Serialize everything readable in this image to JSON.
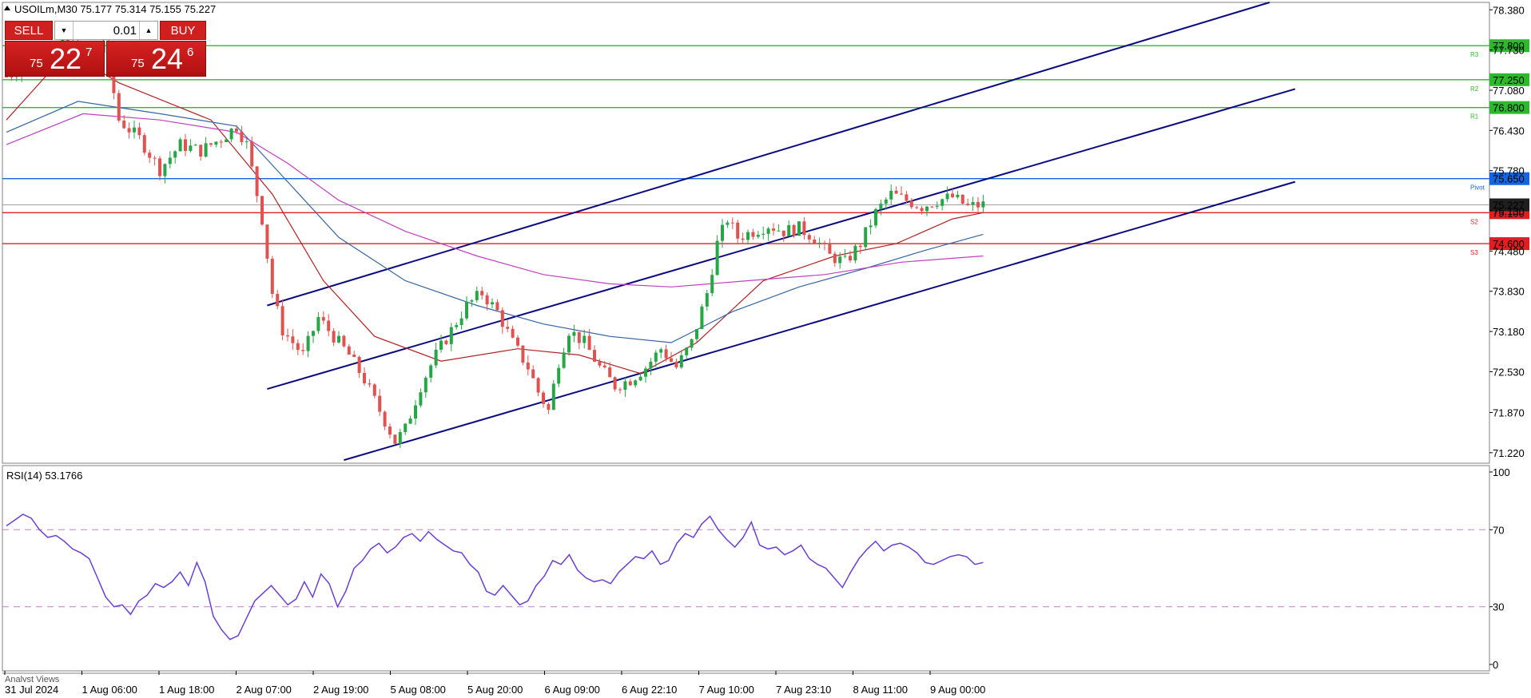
{
  "header": {
    "symbol_line": "USOILm,M30  75.177 75.314 75.155 75.227",
    "rsi_label": "RSI(14) 53.1766"
  },
  "trade_panel": {
    "sell_label": "SELL",
    "buy_label": "BUY",
    "lot_value": "0.01",
    "sell_price_prefix": "75",
    "sell_price_big": "22",
    "sell_price_sup": "7",
    "buy_price_prefix": "75",
    "buy_price_big": "24",
    "buy_price_sup": "6"
  },
  "bottom_tab": "Analyst Views",
  "chart_data": [
    {
      "type": "candlestick",
      "title": "USOILm,M30",
      "ohlc_current": {
        "open": 75.177,
        "high": 75.314,
        "low": 75.155,
        "close": 75.227
      },
      "x_ticks": [
        "31 Jul 2024",
        "1 Aug 06:00",
        "1 Aug 18:00",
        "2 Aug 07:00",
        "2 Aug 19:00",
        "5 Aug 08:00",
        "5 Aug 20:00",
        "6 Aug 09:00",
        "6 Aug 22:10",
        "7 Aug 10:00",
        "7 Aug 23:10",
        "8 Aug 11:00",
        "9 Aug 00:00"
      ],
      "y_ticks": [
        "78.380",
        "77.730",
        "77.080",
        "76.430",
        "75.780",
        "75.130",
        "74.480",
        "73.830",
        "73.180",
        "72.530",
        "71.870",
        "71.220"
      ],
      "ylim": [
        71.05,
        78.5
      ],
      "close_path": [
        [
          0,
          77.3
        ],
        [
          6,
          77.6
        ],
        [
          12,
          77.85
        ],
        [
          17,
          77.5
        ],
        [
          19,
          77.9
        ],
        [
          22,
          76.6
        ],
        [
          26,
          76.3
        ],
        [
          30,
          75.8
        ],
        [
          34,
          76.2
        ],
        [
          38,
          76.1
        ],
        [
          42,
          76.3
        ],
        [
          45,
          76.5
        ],
        [
          47,
          76.2
        ],
        [
          50,
          75.0
        ],
        [
          52,
          73.8
        ],
        [
          54,
          73.2
        ],
        [
          56,
          73.0
        ],
        [
          58,
          72.8
        ],
        [
          61,
          73.4
        ],
        [
          64,
          73.1
        ],
        [
          67,
          72.8
        ],
        [
          70,
          72.4
        ],
        [
          73,
          71.9
        ],
        [
          76,
          71.4
        ],
        [
          78,
          71.6
        ],
        [
          81,
          72.3
        ],
        [
          84,
          72.8
        ],
        [
          87,
          73.2
        ],
        [
          90,
          73.6
        ],
        [
          93,
          73.8
        ],
        [
          96,
          73.5
        ],
        [
          99,
          73.0
        ],
        [
          102,
          72.6
        ],
        [
          104,
          72.2
        ],
        [
          106,
          71.9
        ],
        [
          108,
          72.7
        ],
        [
          110,
          73.2
        ],
        [
          113,
          73.0
        ],
        [
          116,
          72.6
        ],
        [
          119,
          72.3
        ],
        [
          122,
          72.4
        ],
        [
          125,
          72.6
        ],
        [
          128,
          72.9
        ],
        [
          131,
          72.6
        ],
        [
          134,
          73.0
        ],
        [
          137,
          73.8
        ],
        [
          139,
          74.6
        ],
        [
          141,
          75.0
        ],
        [
          143,
          74.7
        ],
        [
          146,
          74.8
        ],
        [
          149,
          74.9
        ],
        [
          152,
          74.8
        ],
        [
          155,
          74.85
        ],
        [
          158,
          74.7
        ],
        [
          161,
          74.4
        ],
        [
          164,
          74.3
        ],
        [
          167,
          74.6
        ],
        [
          170,
          75.1
        ],
        [
          173,
          75.4
        ],
        [
          176,
          75.3
        ],
        [
          179,
          75.2
        ],
        [
          182,
          75.3
        ],
        [
          185,
          75.35
        ],
        [
          188,
          75.2
        ],
        [
          191,
          75.227
        ]
      ],
      "moving_averages": [
        {
          "name": "",
          "color": "#b22222",
          "points": [
            [
              0,
              76.6
            ],
            [
              12,
              77.7
            ],
            [
              22,
              77.2
            ],
            [
              40,
              76.6
            ],
            [
              52,
              75.4
            ],
            [
              62,
              74.0
            ],
            [
              72,
              73.1
            ],
            [
              85,
              72.7
            ],
            [
              100,
              72.9
            ],
            [
              112,
              72.8
            ],
            [
              124,
              72.5
            ],
            [
              135,
              73.0
            ],
            [
              148,
              74.0
            ],
            [
              162,
              74.4
            ],
            [
              174,
              74.6
            ],
            [
              185,
              75.0
            ],
            [
              191,
              75.1
            ]
          ]
        },
        {
          "name": "",
          "color": "#3465a4",
          "points": [
            [
              0,
              76.4
            ],
            [
              14,
              76.9
            ],
            [
              30,
              76.7
            ],
            [
              45,
              76.5
            ],
            [
              55,
              75.6
            ],
            [
              65,
              74.7
            ],
            [
              78,
              74.0
            ],
            [
              92,
              73.6
            ],
            [
              105,
              73.3
            ],
            [
              118,
              73.1
            ],
            [
              130,
              73.0
            ],
            [
              142,
              73.5
            ],
            [
              155,
              73.9
            ],
            [
              168,
              74.2
            ],
            [
              180,
              74.5
            ],
            [
              191,
              74.75
            ]
          ]
        },
        {
          "name": "",
          "color": "#c040c0",
          "points": [
            [
              0,
              76.2
            ],
            [
              15,
              76.7
            ],
            [
              30,
              76.6
            ],
            [
              45,
              76.4
            ],
            [
              55,
              75.9
            ],
            [
              65,
              75.3
            ],
            [
              78,
              74.8
            ],
            [
              92,
              74.4
            ],
            [
              105,
              74.1
            ],
            [
              118,
              73.95
            ],
            [
              130,
              73.9
            ],
            [
              145,
              74.0
            ],
            [
              160,
              74.1
            ],
            [
              175,
              74.3
            ],
            [
              191,
              74.4
            ]
          ]
        }
      ],
      "horizontal_levels": [
        {
          "label": "77.800",
          "value": 77.8,
          "color": "#2db82d",
          "marker": "R3"
        },
        {
          "label": "77.250",
          "value": 77.25,
          "color": "#2db82d",
          "marker": "R2"
        },
        {
          "label": "76.800",
          "value": 76.8,
          "color": "#2db82d",
          "marker": "R1"
        },
        {
          "label": "75.650",
          "value": 75.65,
          "color": "#1565e0",
          "marker": "Pivot"
        },
        {
          "label": "75.100",
          "value": 75.1,
          "color": "#e02020",
          "marker": "S2"
        },
        {
          "label": "74.600",
          "value": 74.6,
          "color": "#e02020",
          "marker": "S3"
        }
      ],
      "current_price": {
        "label": "75.227",
        "value": 75.227
      },
      "trend_channel": [
        {
          "from": [
            51,
            73.6
          ],
          "to": [
            247,
            78.5
          ]
        },
        {
          "from": [
            51,
            72.25
          ],
          "to": [
            252,
            77.1
          ]
        },
        {
          "from": [
            66,
            71.1
          ],
          "to": [
            252,
            75.6
          ]
        }
      ]
    },
    {
      "type": "line",
      "title": "RSI(14) 53.1766",
      "y_ticks": [
        "100",
        "70",
        "30",
        "0"
      ],
      "ylim": [
        0,
        100
      ],
      "levels": [
        70,
        30
      ],
      "values": [
        72,
        75,
        78,
        76,
        70,
        66,
        67,
        64,
        60,
        58,
        55,
        45,
        35,
        30,
        31,
        26,
        33,
        36,
        42,
        40,
        43,
        48,
        41,
        53,
        43,
        25,
        18,
        13,
        15,
        24,
        33,
        37,
        41,
        36,
        31,
        34,
        43,
        35,
        47,
        42,
        30,
        38,
        50,
        54,
        60,
        63,
        58,
        61,
        66,
        68,
        64,
        69,
        65,
        62,
        59,
        58,
        52,
        48,
        38,
        36,
        41,
        36,
        31,
        33,
        41,
        46,
        54,
        52,
        57,
        49,
        45,
        43,
        44,
        42,
        48,
        52,
        56,
        55,
        59,
        52,
        54,
        63,
        68,
        66,
        73,
        77,
        70,
        65,
        61,
        66,
        74,
        62,
        60,
        61,
        57,
        59,
        62,
        55,
        52,
        50,
        45,
        40,
        48,
        55,
        60,
        64,
        59,
        62,
        63,
        61,
        58,
        53,
        52,
        54,
        56,
        57,
        56,
        52,
        53
      ]
    }
  ]
}
